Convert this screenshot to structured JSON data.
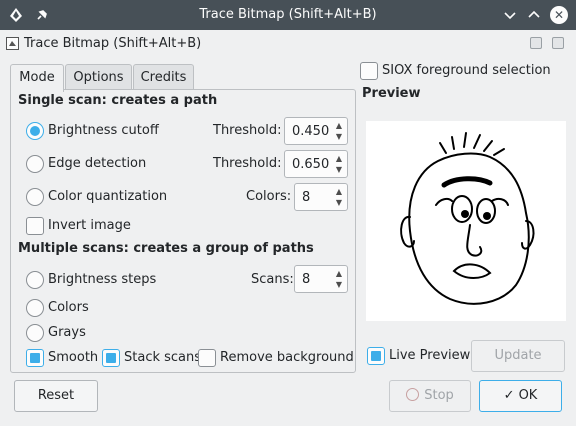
{
  "window": {
    "title": "Trace Bitmap (Shift+Alt+B)"
  },
  "dialog": {
    "title": "Trace Bitmap (Shift+Alt+B)"
  },
  "tabs": [
    {
      "label": "Mode",
      "active": true
    },
    {
      "label": "Options",
      "active": false
    },
    {
      "label": "Credits",
      "active": false
    }
  ],
  "single_scan": {
    "heading": "Single scan: creates a path",
    "brightness": {
      "label": "Brightness cutoff",
      "selected": true,
      "param_label": "Threshold:",
      "value": "0.450"
    },
    "edge": {
      "label": "Edge detection",
      "selected": false,
      "param_label": "Threshold:",
      "value": "0.650"
    },
    "color_quant": {
      "label": "Color quantization",
      "selected": false,
      "param_label": "Colors:",
      "value": "8"
    },
    "invert": {
      "label": "Invert image",
      "checked": false
    }
  },
  "multiple_scans": {
    "heading": "Multiple scans: creates a group of paths",
    "brightness_steps": {
      "label": "Brightness steps",
      "selected": false,
      "param_label": "Scans:",
      "value": "8"
    },
    "colors": {
      "label": "Colors",
      "selected": false
    },
    "grays": {
      "label": "Grays",
      "selected": false
    },
    "smooth": {
      "label": "Smooth",
      "checked": true
    },
    "stack_scans": {
      "label": "Stack scans",
      "checked": true
    },
    "remove_background": {
      "label": "Remove background",
      "checked": false
    }
  },
  "siox": {
    "label": "SIOX foreground selection",
    "checked": false
  },
  "preview": {
    "heading": "Preview",
    "live_label": "Live Preview",
    "live_checked": true,
    "update_label": "Update"
  },
  "buttons": {
    "reset": "Reset",
    "stop": "Stop",
    "ok": "OK"
  },
  "colors": {
    "accent": "#3daee9",
    "titlebar": "#475057",
    "window_bg": "#eff0f1"
  }
}
